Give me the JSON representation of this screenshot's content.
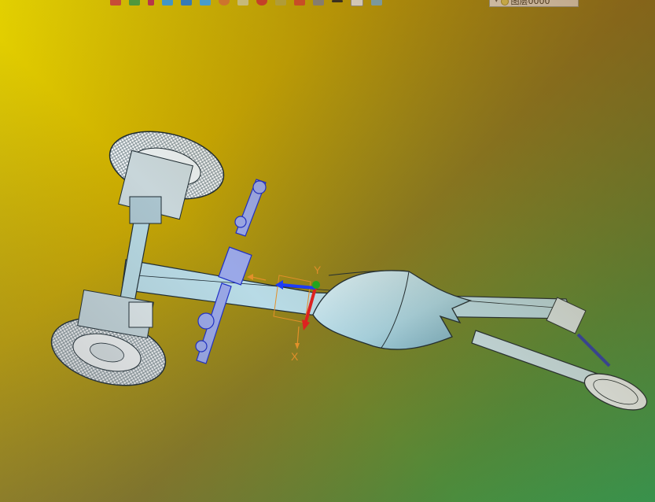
{
  "layer_dropdown": {
    "value": "图层0000"
  },
  "triad": {
    "y_label": "Y",
    "x_label": "X"
  },
  "colors": {
    "accent_red": "#e02020",
    "accent_blue": "#1a3cff",
    "accent_green": "#1fa81f",
    "frame": "#a8d0dc",
    "orange": "#e3902a"
  },
  "toolbar_icons": [
    "undo-icon",
    "redo-icon",
    "pencil-icon",
    "cube-icon",
    "cube-icon-2",
    "cube-icon-3",
    "render-icon",
    "sheet-icon",
    "snap-icon",
    "layer-icon",
    "color-icon",
    "printer-icon",
    "line-icon",
    "page-icon",
    "view-icon"
  ]
}
